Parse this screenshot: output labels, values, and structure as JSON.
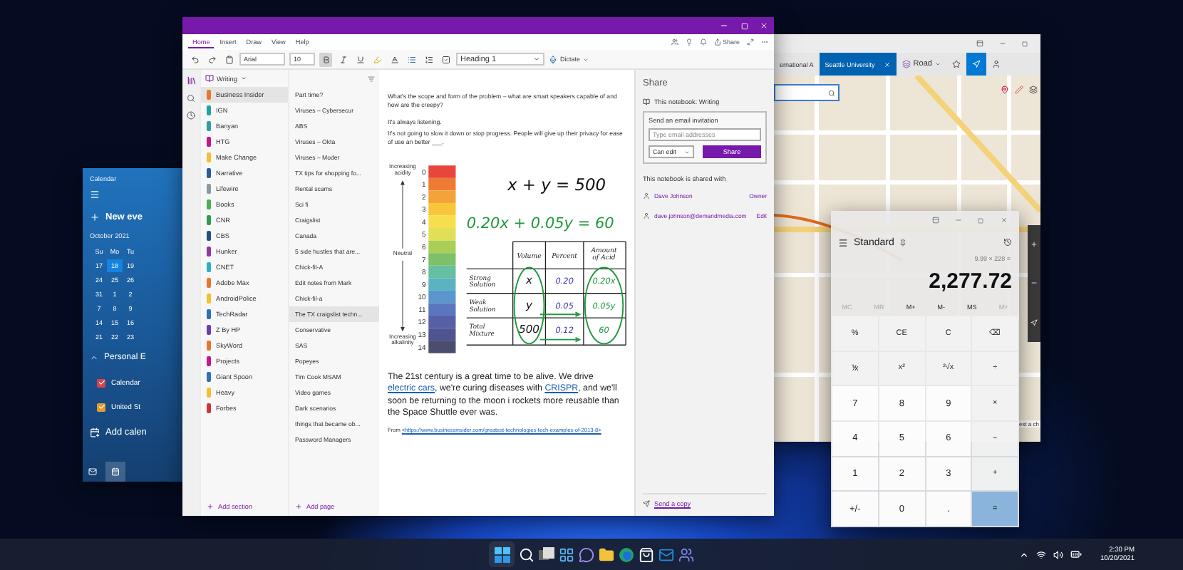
{
  "calendar": {
    "title": "Calendar",
    "new_event": "New eve",
    "month": "October 2021",
    "weekdays": [
      "Su",
      "Mo",
      "Tu"
    ],
    "weeks": [
      [
        {
          "day": "17",
          "selected": false
        },
        {
          "day": "18",
          "selected": true
        },
        {
          "day": "19",
          "selected": false
        }
      ],
      [
        {
          "day": "24",
          "selected": false
        },
        {
          "day": "25",
          "selected": false
        },
        {
          "day": "26",
          "selected": false
        }
      ],
      [
        {
          "day": "31",
          "selected": false
        },
        {
          "day": "1",
          "selected": false
        },
        {
          "day": "2",
          "selected": false
        }
      ],
      [
        {
          "day": "7",
          "selected": false
        },
        {
          "day": "8",
          "selected": false
        },
        {
          "day": "9",
          "selected": false
        }
      ],
      [
        {
          "day": "14",
          "selected": false
        },
        {
          "day": "15",
          "selected": false
        },
        {
          "day": "16",
          "selected": false
        }
      ],
      [
        {
          "day": "21",
          "selected": false
        },
        {
          "day": "22",
          "selected": false
        },
        {
          "day": "23",
          "selected": false
        }
      ]
    ],
    "group": "Personal E",
    "calendars": [
      {
        "label": "Calendar",
        "checked": true,
        "color": "#d9434b"
      },
      {
        "label": "United St",
        "checked": true,
        "color": "#e89a2c"
      }
    ],
    "add_calendar": "Add calen"
  },
  "onenote": {
    "tabs": [
      {
        "label": "Home",
        "selected": true
      },
      {
        "label": "Insert",
        "selected": false
      },
      {
        "label": "Draw",
        "selected": false
      },
      {
        "label": "View",
        "selected": false
      },
      {
        "label": "Help",
        "selected": false
      }
    ],
    "share_button": "Share",
    "toolbar": {
      "font": "Arial",
      "size": "10",
      "bold_on": true,
      "style": "Heading 1",
      "dictate": "Dictate"
    },
    "notebook": "Writing",
    "sections": [
      {
        "name": "Business Insider",
        "color": "#e8772e",
        "selected": true
      },
      {
        "name": "IGN",
        "color": "#1fa3a3",
        "selected": false
      },
      {
        "name": "Banyan",
        "color": "#2e9fa0",
        "selected": false
      },
      {
        "name": "HTG",
        "color": "#c2188a",
        "selected": false
      },
      {
        "name": "Make Change",
        "color": "#f2c12e",
        "selected": false
      },
      {
        "name": "Narrative",
        "color": "#2b5d9a",
        "selected": false
      },
      {
        "name": "Lifewire",
        "color": "#8a9aa0",
        "selected": false
      },
      {
        "name": "Books",
        "color": "#4caf50",
        "selected": false
      },
      {
        "name": "CNR",
        "color": "#2e9e4a",
        "selected": false
      },
      {
        "name": "CBS",
        "color": "#24507f",
        "selected": false
      },
      {
        "name": "Hunker",
        "color": "#8b3aa6",
        "selected": false
      },
      {
        "name": "CNET",
        "color": "#2ab0c8",
        "selected": false
      },
      {
        "name": "Adobe Max",
        "color": "#e8772e",
        "selected": false
      },
      {
        "name": "AndroidPolice",
        "color": "#f2c12e",
        "selected": false
      },
      {
        "name": "TechRadar",
        "color": "#2f6fb3",
        "selected": false
      },
      {
        "name": "Z By HP",
        "color": "#6a3fb0",
        "selected": false
      },
      {
        "name": "SkyWord",
        "color": "#e8772e",
        "selected": false
      },
      {
        "name": "Projects",
        "color": "#c2188a",
        "selected": false
      },
      {
        "name": "Giant Spoon",
        "color": "#2f6fb3",
        "selected": false
      },
      {
        "name": "Heavy",
        "color": "#f2c12e",
        "selected": false
      },
      {
        "name": "Forbes",
        "color": "#d13438",
        "selected": false
      }
    ],
    "pages": [
      {
        "title": "Part time?",
        "selected": false
      },
      {
        "title": "Viruses – Cybersecur",
        "selected": false
      },
      {
        "title": "ABS",
        "selected": false
      },
      {
        "title": "Viruses – Okta",
        "selected": false
      },
      {
        "title": "Viruses – Moder",
        "selected": false
      },
      {
        "title": "TX tips for shopping fo...",
        "selected": false
      },
      {
        "title": "Rental scams",
        "selected": false
      },
      {
        "title": "Sci fi",
        "selected": false
      },
      {
        "title": "Craigslist",
        "selected": false
      },
      {
        "title": "Canada",
        "selected": false
      },
      {
        "title": "5 side hustles that are...",
        "selected": false
      },
      {
        "title": "Chick-fil-A",
        "selected": false
      },
      {
        "title": "Edit notes from Mark",
        "selected": false
      },
      {
        "title": "Chick-fil-a",
        "selected": false
      },
      {
        "title": "The TX craigslist techn...",
        "selected": true
      },
      {
        "title": "Conservative",
        "selected": false
      },
      {
        "title": "SAS",
        "selected": false
      },
      {
        "title": "Popeyes",
        "selected": false
      },
      {
        "title": "Tim Cook MSAM",
        "selected": false
      },
      {
        "title": "Video games",
        "selected": false
      },
      {
        "title": "Dark scenarios",
        "selected": false
      },
      {
        "title": "things that became ob...",
        "selected": false
      },
      {
        "title": "Password Managers",
        "selected": false
      }
    ],
    "add_section": "Add section",
    "add_page": "Add page",
    "page": {
      "paragraphs": [
        "What's the scope and form of the problem – what are smart speakers capable of and how are the creepy?",
        "It's always listening.",
        "It's not going to slow it down or stop progress. People will give up their privacy for ease of use an better ___."
      ],
      "ink": {
        "ph_numbers": [
          "0",
          "1",
          "2",
          "3",
          "4",
          "5",
          "6",
          "7",
          "8",
          "9",
          "10",
          "11",
          "12",
          "13",
          "14"
        ],
        "ph_labels": [
          "Increasing acidity",
          "Neutral",
          "Increasing alkalinity"
        ],
        "equations": [
          {
            "text": "x + y = 500",
            "color": "#111111"
          },
          {
            "text": "0.20x + 0.05y = 60",
            "color": "#1f9a3c"
          }
        ],
        "headers": [
          "Volume",
          "Percent",
          "Amount of Acid"
        ],
        "rows": [
          {
            "label": "Strong Solution",
            "cells": [
              "x",
              "0.20",
              "0.20x"
            ]
          },
          {
            "label": "Weak Solution",
            "cells": [
              "y",
              "0.05",
              "0.05y"
            ]
          },
          {
            "label": "Total Mixture",
            "cells": [
              "500",
              "0.12",
              "60"
            ]
          }
        ]
      },
      "body_parts": [
        {
          "kind": "text",
          "text": "The 21st century is a great time to be alive. We drive "
        },
        {
          "kind": "link",
          "text": "electric cars"
        },
        {
          "kind": "text",
          "text": ", we're curing diseases with "
        },
        {
          "kind": "link",
          "text": "CRISPR"
        },
        {
          "kind": "text",
          "text": ", and we'll soon be returning to the moon i rockets more reusable than the Space Shuttle ever was."
        }
      ],
      "source": {
        "prefix": "From ",
        "link": "<https://www.businessinsider.com/greatest-technologies-tech-examples-of-2013-8>"
      }
    },
    "share_panel": {
      "title": "Share",
      "notebook": "This notebook: Writing",
      "invite_title": "Send an email invitation",
      "email_placeholder": "Type email addresses",
      "permission": "Can edit",
      "share_button": "Share",
      "shared_with": "This notebook is shared with",
      "people": [
        {
          "name": "Dave Johnson",
          "role": "Owner"
        },
        {
          "name": "dave.johnson@demandmedia.com",
          "role": "Edit"
        }
      ],
      "send_copy": "Send a copy"
    }
  },
  "maps": {
    "tabs": [
      {
        "label": "ernational A",
        "selected": false
      },
      {
        "label": "Seattle University",
        "selected": true
      }
    ],
    "view": "Road",
    "notice": "est a ch"
  },
  "calculator": {
    "mode": "Standard",
    "expression": "9.99 × 228 =",
    "display": "2,277.72",
    "memory": [
      {
        "label": "MC",
        "disabled": true
      },
      {
        "label": "MR",
        "disabled": true
      },
      {
        "label": "M+",
        "disabled": false
      },
      {
        "label": "M-",
        "disabled": false
      },
      {
        "label": "MS",
        "disabled": false
      },
      {
        "label": "M˅",
        "disabled": true
      }
    ],
    "keys": [
      {
        "label": "%",
        "kind": "function"
      },
      {
        "label": "CE",
        "kind": "function"
      },
      {
        "label": "C",
        "kind": "function"
      },
      {
        "label": "⌫",
        "kind": "function"
      },
      {
        "label": "⅟x",
        "kind": "function"
      },
      {
        "label": "x²",
        "kind": "function"
      },
      {
        "label": "²√x",
        "kind": "function"
      },
      {
        "label": "÷",
        "kind": "function"
      },
      {
        "label": "7",
        "kind": "digit"
      },
      {
        "label": "8",
        "kind": "digit"
      },
      {
        "label": "9",
        "kind": "digit"
      },
      {
        "label": "×",
        "kind": "function"
      },
      {
        "label": "4",
        "kind": "digit"
      },
      {
        "label": "5",
        "kind": "digit"
      },
      {
        "label": "6",
        "kind": "digit"
      },
      {
        "label": "−",
        "kind": "function"
      },
      {
        "label": "1",
        "kind": "digit"
      },
      {
        "label": "2",
        "kind": "digit"
      },
      {
        "label": "3",
        "kind": "digit"
      },
      {
        "label": "+",
        "kind": "function"
      },
      {
        "label": "+/-",
        "kind": "digit"
      },
      {
        "label": "0",
        "kind": "digit"
      },
      {
        "label": ".",
        "kind": "digit"
      },
      {
        "label": "=",
        "kind": "equals"
      }
    ]
  },
  "taskbar": {
    "time": "2:30 PM",
    "date": "10/20/2021"
  }
}
